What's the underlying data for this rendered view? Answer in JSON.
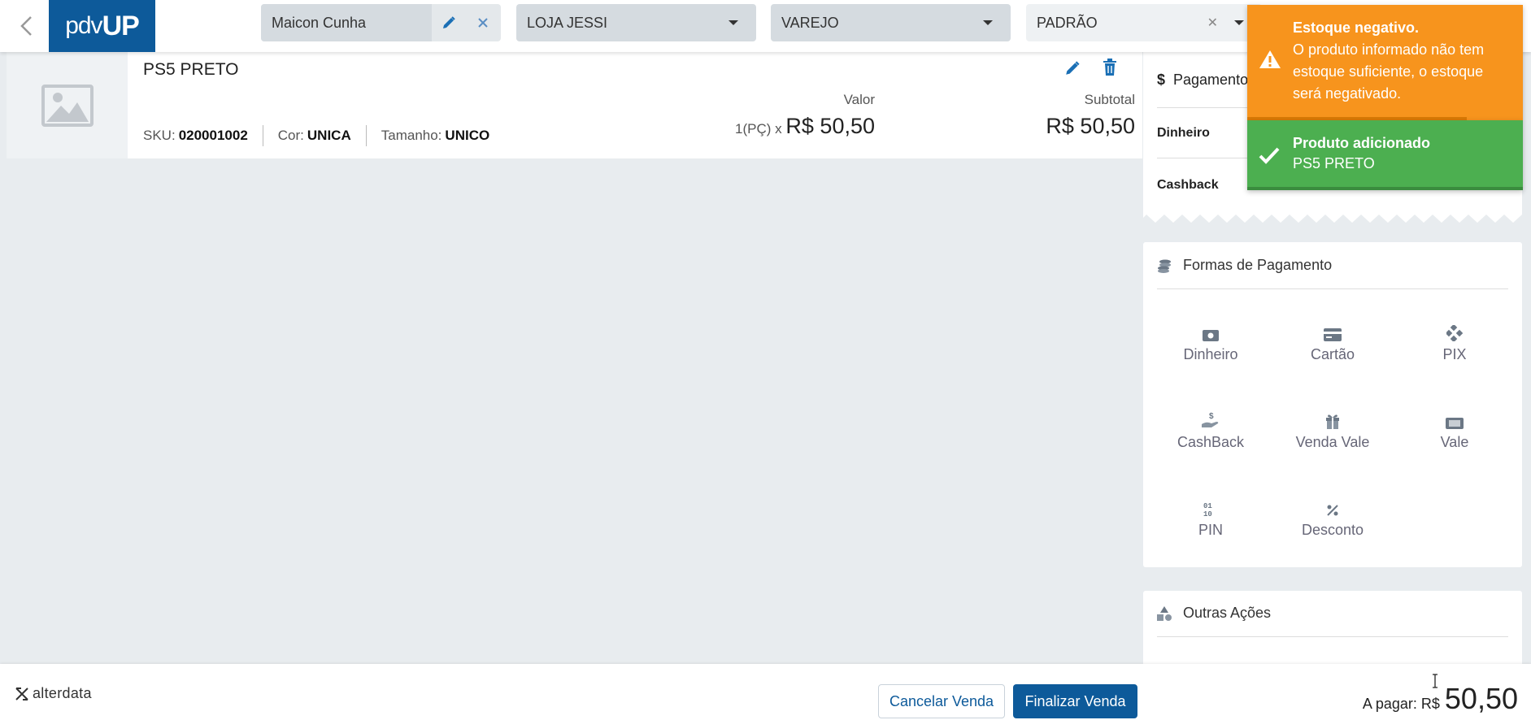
{
  "header": {
    "logo_prefix": "pdv",
    "logo_suffix": "UP",
    "client": "Maicon Cunha",
    "store": "LOJA JESSI",
    "sale_type": "VAREJO",
    "price_table": "PADRÃO"
  },
  "product": {
    "name": "PS5 PRETO",
    "sku_label": "SKU:",
    "sku": "020001002",
    "color_label": "Cor:",
    "color": "UNICA",
    "size_label": "Tamanho:",
    "size": "UNICO",
    "value_label": "Valor",
    "qty": "1(PÇ) x",
    "unit_price": "R$ 50,50",
    "subtotal_label": "Subtotal",
    "subtotal": "R$ 50,50"
  },
  "payment_summary": {
    "title": "Pagamento",
    "rows": [
      "Dinheiro",
      "Cashback"
    ]
  },
  "payment_forms": {
    "title": "Formas de Pagamento",
    "items": [
      {
        "label": "Dinheiro",
        "icon": "money-icon"
      },
      {
        "label": "Cartão",
        "icon": "card-icon"
      },
      {
        "label": "PIX",
        "icon": "pix-icon"
      },
      {
        "label": "CashBack",
        "icon": "cashback-icon"
      },
      {
        "label": "Venda Vale",
        "icon": "gift-icon"
      },
      {
        "label": "Vale",
        "icon": "voucher-icon"
      },
      {
        "label": "PIN",
        "icon": "pin-icon"
      },
      {
        "label": "Desconto",
        "icon": "percent-icon"
      }
    ]
  },
  "other_actions": {
    "title": "Outras Ações"
  },
  "footer": {
    "brand": "alterdata",
    "cancel_label": "Cancelar Venda",
    "finish_label": "Finalizar Venda",
    "to_pay_label": "A pagar: R$",
    "to_pay_value": "50,50"
  },
  "toasts": {
    "warning_title": "Estoque negativo.",
    "warning_message": "O produto informado não tem estoque suficiente, o estoque será negativado.",
    "success_title": "Produto adicionado",
    "success_message": "PS5 PRETO"
  },
  "colors": {
    "brand_blue": "#0d5a9a",
    "warning": "#f7941d",
    "success": "#4caf50",
    "background": "#e8ecef"
  }
}
